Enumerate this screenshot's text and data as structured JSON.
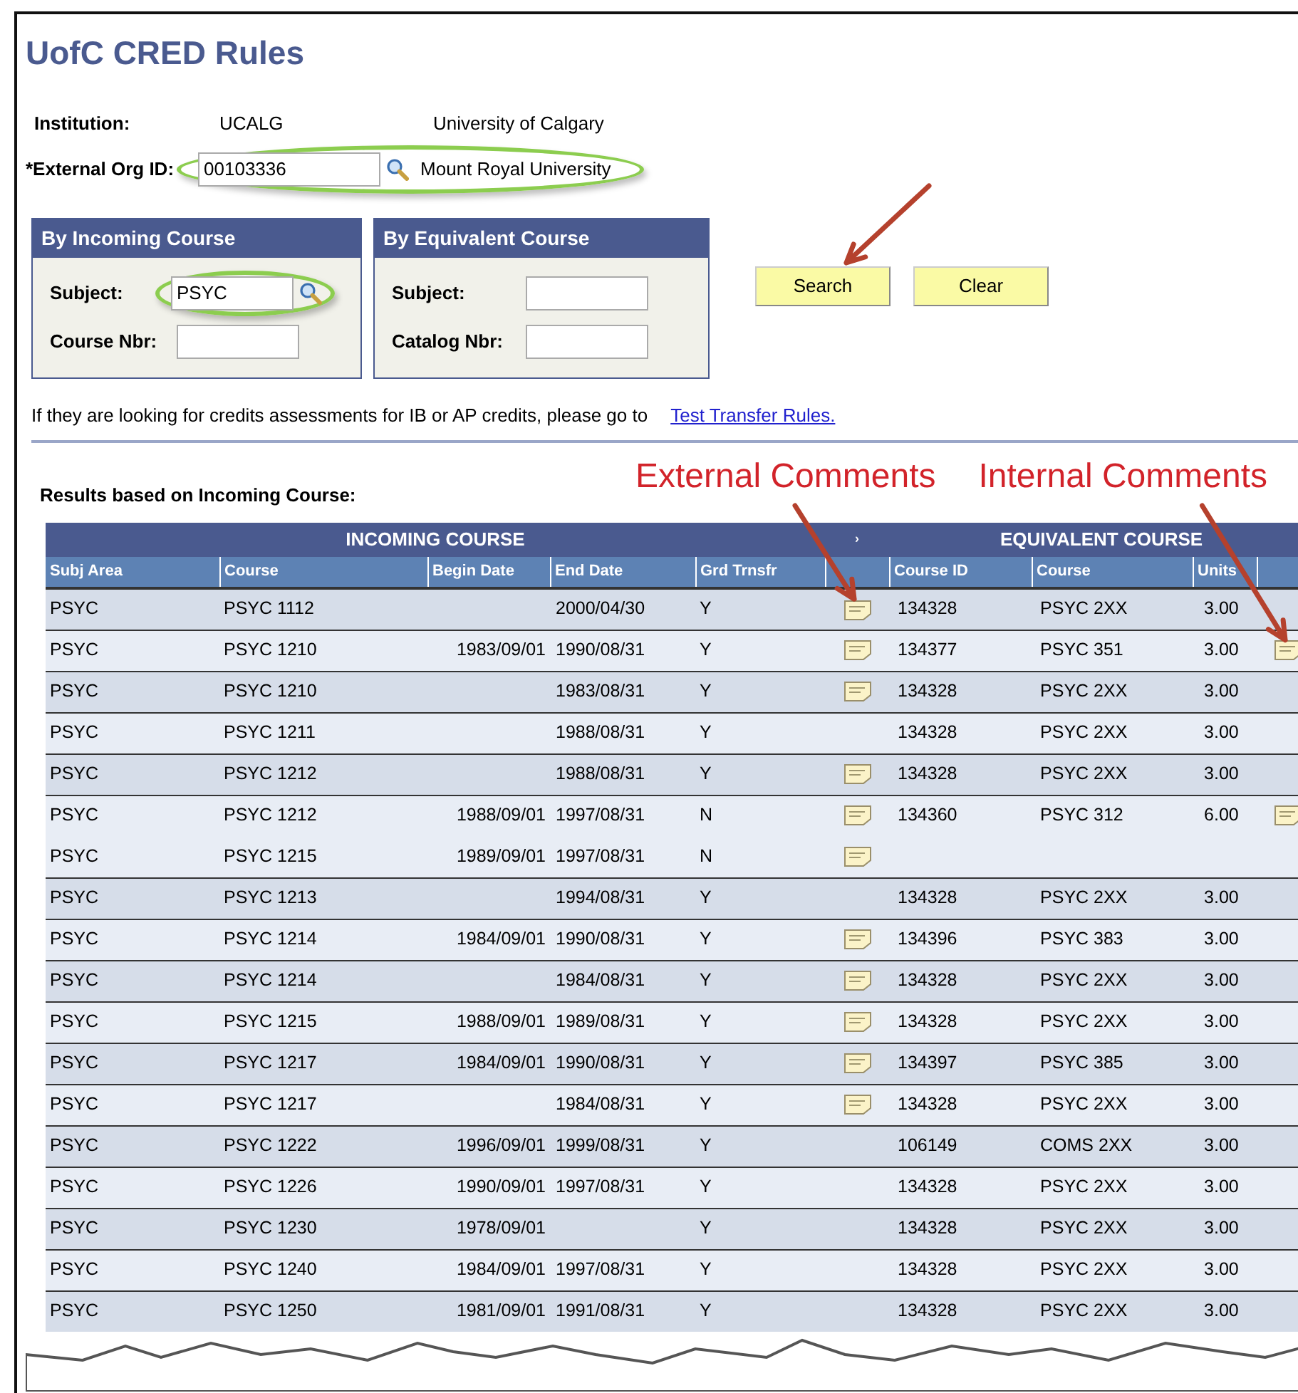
{
  "page": {
    "title": "UofC CRED Rules"
  },
  "institution": {
    "label": "Institution:",
    "code": "UCALG",
    "name": "University of Calgary"
  },
  "external_org": {
    "label": "*External Org ID:",
    "value": "00103336",
    "name": "Mount Royal University",
    "highlighted": true
  },
  "panels": [
    {
      "title": "By Incoming Course",
      "fields": [
        {
          "label": "Subject:",
          "value": "PSYC",
          "lookup": true,
          "highlighted": true
        },
        {
          "label": "Course Nbr:",
          "lookup": false,
          "highlighted": false
        }
      ]
    },
    {
      "title": "By Equivalent Course",
      "fields": [
        {
          "label": "Subject:",
          "lookup": false,
          "highlighted": false
        },
        {
          "label": "Catalog Nbr:",
          "lookup": false,
          "highlighted": false
        }
      ]
    }
  ],
  "buttons": [
    {
      "label": "Search",
      "callout": true
    },
    {
      "label": "Clear",
      "callout": false
    }
  ],
  "note": {
    "text": "If they are looking for credits assessments for IB or AP credits, please go to",
    "link": "Test Transfer Rules."
  },
  "results": {
    "heading": "Results based on Incoming Course:",
    "annotations": [
      {
        "kind": "external",
        "text": "External Comments"
      },
      {
        "kind": "internal",
        "text": "Internal Comments"
      }
    ],
    "groups": [
      "INCOMING COURSE",
      "›",
      "EQUIVALENT COURSE"
    ],
    "columns": [
      "Subj Area",
      "Course",
      "Begin Date",
      "End Date",
      "Grd Trnsfr",
      "",
      "Course ID",
      "Course",
      "Units",
      ""
    ],
    "rows": [
      {
        "subj": "PSYC",
        "course": "PSYC 1112",
        "end": "2000/04/30",
        "grd": "Y",
        "ext_comment": true,
        "course_id": "134328",
        "eq_course": "PSYC 2XX",
        "units": "3.00",
        "int_comment": false,
        "continued": false
      },
      {
        "subj": "PSYC",
        "course": "PSYC 1210",
        "begin": "1983/09/01",
        "end": "1990/08/31",
        "grd": "Y",
        "ext_comment": true,
        "course_id": "134377",
        "eq_course": "PSYC 351",
        "units": "3.00",
        "int_comment": true,
        "continued": false
      },
      {
        "subj": "PSYC",
        "course": "PSYC 1210",
        "end": "1983/08/31",
        "grd": "Y",
        "ext_comment": true,
        "course_id": "134328",
        "eq_course": "PSYC 2XX",
        "units": "3.00",
        "int_comment": false,
        "continued": false
      },
      {
        "subj": "PSYC",
        "course": "PSYC 1211",
        "end": "1988/08/31",
        "grd": "Y",
        "ext_comment": false,
        "course_id": "134328",
        "eq_course": "PSYC 2XX",
        "units": "3.00",
        "int_comment": false,
        "continued": false
      },
      {
        "subj": "PSYC",
        "course": "PSYC 1212",
        "end": "1988/08/31",
        "grd": "Y",
        "ext_comment": true,
        "course_id": "134328",
        "eq_course": "PSYC 2XX",
        "units": "3.00",
        "int_comment": false,
        "continued": false
      },
      {
        "subj": "PSYC",
        "course": "PSYC 1212",
        "begin": "1988/09/01",
        "end": "1997/08/31",
        "grd": "N",
        "ext_comment": true,
        "course_id": "134360",
        "eq_course": "PSYC 312",
        "units": "6.00",
        "int_comment": true,
        "continued": false
      },
      {
        "subj": "PSYC",
        "course": "PSYC 1215",
        "begin": "1989/09/01",
        "end": "1997/08/31",
        "grd": "N",
        "ext_comment": true,
        "int_comment": false,
        "continued": true
      },
      {
        "subj": "PSYC",
        "course": "PSYC 1213",
        "end": "1994/08/31",
        "grd": "Y",
        "ext_comment": false,
        "course_id": "134328",
        "eq_course": "PSYC 2XX",
        "units": "3.00",
        "int_comment": false,
        "continued": false
      },
      {
        "subj": "PSYC",
        "course": "PSYC 1214",
        "begin": "1984/09/01",
        "end": "1990/08/31",
        "grd": "Y",
        "ext_comment": true,
        "course_id": "134396",
        "eq_course": "PSYC 383",
        "units": "3.00",
        "int_comment": false,
        "continued": false
      },
      {
        "subj": "PSYC",
        "course": "PSYC 1214",
        "end": "1984/08/31",
        "grd": "Y",
        "ext_comment": true,
        "course_id": "134328",
        "eq_course": "PSYC 2XX",
        "units": "3.00",
        "int_comment": false,
        "continued": false
      },
      {
        "subj": "PSYC",
        "course": "PSYC 1215",
        "begin": "1988/09/01",
        "end": "1989/08/31",
        "grd": "Y",
        "ext_comment": true,
        "course_id": "134328",
        "eq_course": "PSYC 2XX",
        "units": "3.00",
        "int_comment": false,
        "continued": false
      },
      {
        "subj": "PSYC",
        "course": "PSYC 1217",
        "begin": "1984/09/01",
        "end": "1990/08/31",
        "grd": "Y",
        "ext_comment": true,
        "course_id": "134397",
        "eq_course": "PSYC 385",
        "units": "3.00",
        "int_comment": false,
        "continued": false
      },
      {
        "subj": "PSYC",
        "course": "PSYC 1217",
        "end": "1984/08/31",
        "grd": "Y",
        "ext_comment": true,
        "course_id": "134328",
        "eq_course": "PSYC 2XX",
        "units": "3.00",
        "int_comment": false,
        "continued": false
      },
      {
        "subj": "PSYC",
        "course": "PSYC 1222",
        "begin": "1996/09/01",
        "end": "1999/08/31",
        "grd": "Y",
        "ext_comment": false,
        "course_id": "106149",
        "eq_course": "COMS 2XX",
        "units": "3.00",
        "int_comment": false,
        "continued": false
      },
      {
        "subj": "PSYC",
        "course": "PSYC 1226",
        "begin": "1990/09/01",
        "end": "1997/08/31",
        "grd": "Y",
        "ext_comment": false,
        "course_id": "134328",
        "eq_course": "PSYC 2XX",
        "units": "3.00",
        "int_comment": false,
        "continued": false
      },
      {
        "subj": "PSYC",
        "course": "PSYC 1230",
        "begin": "1978/09/01",
        "grd": "Y",
        "ext_comment": false,
        "course_id": "134328",
        "eq_course": "PSYC 2XX",
        "units": "3.00",
        "int_comment": false,
        "continued": false
      },
      {
        "subj": "PSYC",
        "course": "PSYC 1240",
        "begin": "1984/09/01",
        "end": "1997/08/31",
        "grd": "Y",
        "ext_comment": false,
        "course_id": "134328",
        "eq_course": "PSYC 2XX",
        "units": "3.00",
        "int_comment": false,
        "continued": false
      },
      {
        "subj": "PSYC",
        "course": "PSYC 1250",
        "begin": "1981/09/01",
        "end": "1991/08/31",
        "grd": "Y",
        "ext_comment": false,
        "course_id": "134328",
        "eq_course": "PSYC 2XX",
        "units": "3.00",
        "int_comment": false,
        "continued": false
      }
    ]
  }
}
